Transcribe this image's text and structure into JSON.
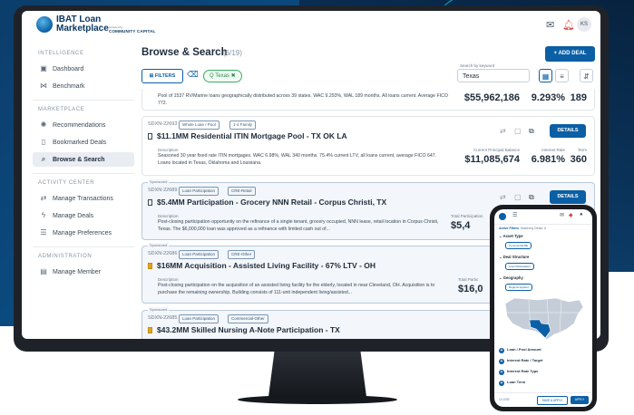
{
  "app": {
    "brand_line1": "IBAT Loan",
    "brand_line2": "Marketplace",
    "powered_by": "powered by",
    "partner": "COMMUNITY CAPITAL",
    "avatar_initials": "KS"
  },
  "sidebar": {
    "sections": [
      {
        "label": "INTELLIGENCE",
        "items": [
          {
            "label": "Dashboard",
            "icon": "dashboard-icon"
          },
          {
            "label": "Benchmark",
            "icon": "benchmark-icon"
          }
        ]
      },
      {
        "label": "MARKETPLACE",
        "items": [
          {
            "label": "Recommendations",
            "icon": "recommendations-icon"
          },
          {
            "label": "Bookmarked Deals",
            "icon": "bookmark-icon"
          },
          {
            "label": "Browse & Search",
            "icon": "search-icon",
            "active": true
          }
        ]
      },
      {
        "label": "ACTIVITY CENTER",
        "items": [
          {
            "label": "Manage Transactions",
            "icon": "transactions-icon"
          },
          {
            "label": "Manage Deals",
            "icon": "deals-icon"
          },
          {
            "label": "Manage Preferences",
            "icon": "preferences-icon"
          }
        ]
      },
      {
        "label": "ADMINISTRATION",
        "items": [
          {
            "label": "Manage Member",
            "icon": "member-icon"
          }
        ]
      }
    ]
  },
  "main": {
    "title": "Browse & Search",
    "count": "(6/19)",
    "add_deal": "+ ADD DEAL",
    "filters": "FILTERS",
    "chip": "Q Texas",
    "search_label": "Search by keyword",
    "search_value": "Texas"
  },
  "deals": [
    {
      "desc": "Pool of 1537 RV/Marine loans geographically distributed across 39 states. WAC 9.293%, WAL 189 months. All loans current. Average FICO 772.",
      "balance": "$55,962,186",
      "rate": "9.293%",
      "term": "189"
    },
    {
      "id": "SDXN-22693",
      "tags": [
        "Whole Loan / Pool",
        "1-4 Family"
      ],
      "title": "$11.1MM Residential ITIN Mortgage Pool - TX OK LA",
      "desc_label": "Description",
      "desc": "Seasoned 30 year fixed rate ITIN mortgages. WAC 6.98%, WAL 340 months. 75.4% current LTV, all loans current, average FICO 647. Loans located in Texas, Oklahoma and Louisiana.",
      "balance_label": "Current Principal Balance",
      "rate_label": "Interest Rate",
      "term_label": "Term",
      "balance": "$11,085,674",
      "rate": "6.981%",
      "term": "360",
      "details": "DETAILS"
    },
    {
      "sponsored": "Sponsored",
      "id": "SDXN-22689",
      "tags": [
        "Loan Participation",
        "CRE-Retail"
      ],
      "title": "$5.4MM Participation - Grocery NNN Retail - Corpus Christi, TX",
      "desc_label": "Description",
      "desc": "Post-closing participation opportunity on the refinance of a single tenant, grocery occupied, NNN lease, retail location in Corpus Christi, Texas. The $6,000,000 loan was approved as a refinance with limited cash out of...",
      "balance_label": "Total Participation",
      "balance": "$5,4",
      "details": "DETAILS"
    },
    {
      "sponsored": "Sponsored",
      "id": "SDXN-22686",
      "tags": [
        "Loan Participation",
        "CRE-Other"
      ],
      "title": "$16MM Acquisition - Assisted Living Facility - 67% LTV - OH",
      "desc_label": "Description",
      "desc": "Post-closing participation on the acquisition of an assisted living facility for the elderly, located in near Cleveland, OH. Acquisition is to purchase the remaining ownership. Building consists of 111-unit independent living/assisted...",
      "balance_label": "Total Partic",
      "balance": "$16,0"
    },
    {
      "sponsored": "Sponsored",
      "id": "SDXN-22685",
      "tags": [
        "Loan Participation",
        "Commercial-Other"
      ],
      "title": "$43.2MM Skilled Nursing A-Note Participation - TX"
    }
  ],
  "mobile": {
    "tab_active": "Active Filters",
    "tab_matching": "Matching Deals: 6",
    "sections": [
      {
        "label": "Asset Type",
        "chip": "Commercial-RE"
      },
      {
        "label": "Deal Structure",
        "chip": "Loan Participation"
      },
      {
        "label": "Geography",
        "chip": "Regions Applied"
      }
    ],
    "rows": [
      "Loan / Pool Amount",
      "Interest Rate / Target",
      "Interest Rate Type",
      "Loan Term"
    ],
    "close": "CLOSE",
    "save_apply": "SAVE & APPLY",
    "apply": "APPLY"
  },
  "colors": {
    "primary": "#0b5fa5",
    "sponsored_bg": "#f3f6fa",
    "chip_green": "#3cae62",
    "bookmark_gold": "#e0a71f",
    "map_highlight": "#0b5fa5"
  }
}
